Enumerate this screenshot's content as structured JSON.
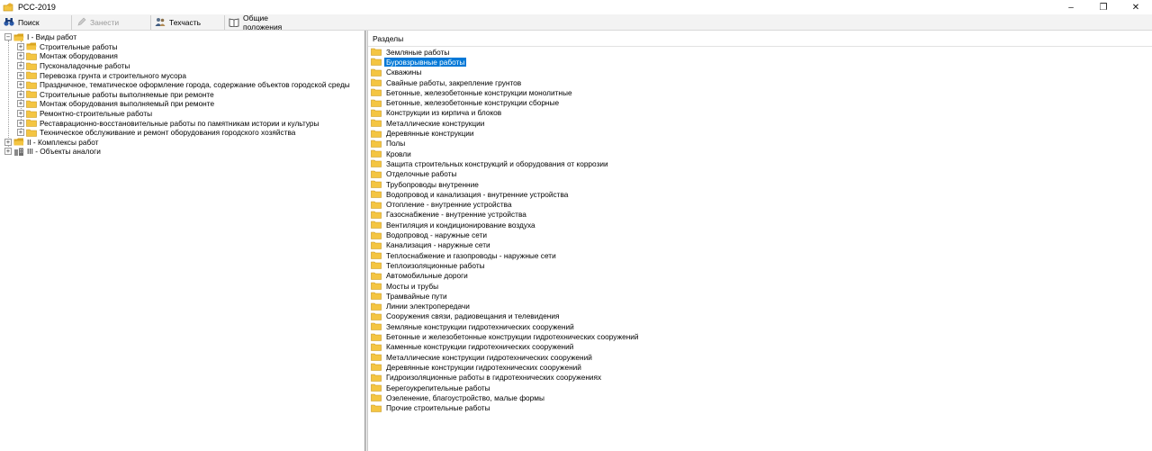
{
  "window": {
    "title": "РСС-2019",
    "controls": [
      "–",
      "❐",
      "✕"
    ]
  },
  "toolbar": [
    {
      "label": "Поиск",
      "icon": "binoculars-icon",
      "disabled": false
    },
    {
      "label": "Занести",
      "icon": "pencil-icon",
      "disabled": true
    },
    {
      "label": "Техчасть",
      "icon": "people-icon",
      "disabled": false
    },
    {
      "label": "Общие положения",
      "icon": "book-icon",
      "disabled": false
    }
  ],
  "tree": {
    "root": {
      "label": "I - Виды работ",
      "expanded": true
    },
    "children": [
      "Строительные работы",
      "Монтаж оборудования",
      "Пусконаладочные работы",
      "Перевозка грунта и строительного мусора",
      "Праздничное, тематическое оформление города, содержание объектов городской среды",
      "Строительные работы выполняемые при ремонте",
      "Монтаж оборудования выполняемый при ремонте",
      "Ремонтно-строительные работы",
      "Реставрационно-восстановительные работы по памятникам истории и культуры",
      "Техническое обслуживание и ремонт оборудования городского хозяйства"
    ],
    "other_roots": [
      {
        "label": "II - Комплексы работ"
      },
      {
        "label": "III - Объекты аналоги"
      }
    ]
  },
  "list": {
    "header": "Разделы",
    "selected_index": 1,
    "items": [
      "Земляные работы",
      "Буровзрывные работы",
      "Скважины",
      "Свайные работы, закрепление грунтов",
      "Бетонные, железобетонные конструкции монолитные",
      "Бетонные, железобетонные конструкции сборные",
      "Конструкции из кирпича и блоков",
      "Металлические конструкции",
      "Деревянные конструкции",
      "Полы",
      "Кровли",
      "Защита строительных конструкций и оборудования от коррозии",
      "Отделочные работы",
      "Трубопроводы внутренние",
      "Водопровод и канализация - внутренние устройства",
      "Отопление - внутренние устройства",
      "Газоснабжение - внутренние устройства",
      "Вентиляция и кондиционирование воздуха",
      "Водопровод - наружные сети",
      "Канализация - наружные сети",
      "Теплоснабжение и газопроводы - наружные сети",
      "Теплоизоляционные работы",
      "Автомобильные дороги",
      "Мосты и трубы",
      "Трамвайные пути",
      "Линии электропередачи",
      "Сооружения связи, радиовещания и телевидения",
      "Земляные конструкции гидротехнических сооружений",
      "Бетонные и железобетонные конструкции гидротехнических сооружений",
      "Каменные конструкции гидротехнических сооружений",
      "Металлические конструкции гидротехнических сооружений",
      "Деревянные конструкции гидротехнических сооружений",
      "Гидроизоляционные работы в гидротехнических сооружениях",
      "Берегоукрепительные работы",
      "Озеленение, благоустройство, малые формы",
      "Прочие строительные работы"
    ]
  },
  "colors": {
    "selection": "#0078d7",
    "folder": "#f4c542",
    "folder_dark": "#d9a520"
  }
}
